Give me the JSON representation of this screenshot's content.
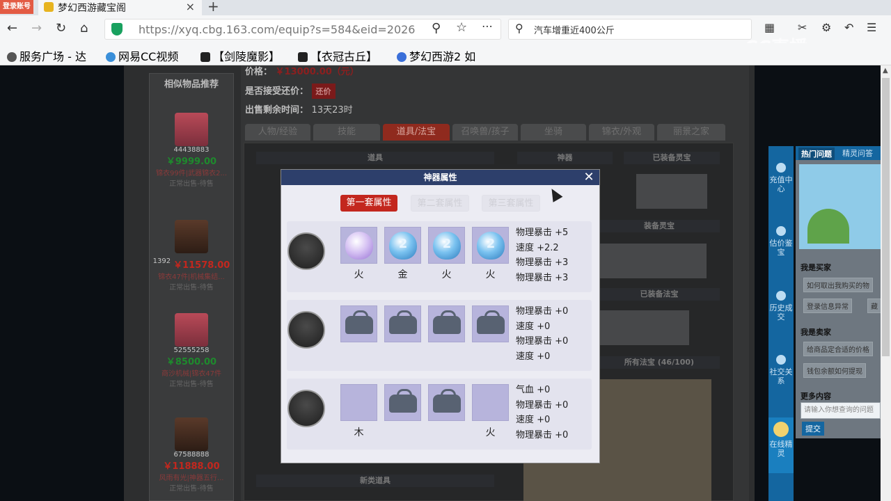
{
  "browser": {
    "login_badge": "登录账号",
    "tab_title": "梦幻西游藏宝阁",
    "tab_close": "×",
    "new_tab": "+",
    "url": "https://xyq.cbg.163.com/equip?s=584&eid=2026",
    "search_text": "汽车增重近400公斤",
    "watermark": "CC直播"
  },
  "bookmarks": [
    {
      "label": "服务广场 - 达",
      "icon": "globe-icon"
    },
    {
      "label": "网易CC视频",
      "icon": "cc-icon"
    },
    {
      "label": "【剑陵魔影】",
      "icon": "dashen-icon"
    },
    {
      "label": "【衣冠古丘】",
      "icon": "dashen-icon"
    },
    {
      "label": "梦幻西游2 如",
      "icon": "paw-icon"
    }
  ],
  "info": {
    "price_label": "价格：",
    "price_value": "￥13000.00（元）",
    "bargain_label": "是否接受还价：",
    "bargain_button": "还价",
    "remaining_label": "出售剩余时间：",
    "remaining_value": "13天23时"
  },
  "tabs": [
    "人物/经验",
    "技能",
    "道具/法宝",
    "召唤兽/孩子",
    "坐骑",
    "锦衣/外观",
    "丽景之家"
  ],
  "panels": {
    "items": "道具",
    "artifact": "神器",
    "spirit_equipped": "已装备灵宝",
    "spirit2": "装备灵宝",
    "fabao_equipped": "已装备法宝",
    "fabao_all": "所有法宝 (46/100)",
    "new_items": "新类道具"
  },
  "sidebar": {
    "title": "相似物品推荐",
    "items": [
      {
        "id": "44438883",
        "price": "￥9999.00",
        "desc": "锦衣99件|武器锦衣2...",
        "status": "正常出售-待售"
      },
      {
        "id": "1392",
        "price": "￥11578.00",
        "desc": "锦衣47件|机械集结...",
        "status": "正常出售-待售"
      },
      {
        "id": "52555258",
        "price": "￥8500.00",
        "desc": "商沙机械|锦衣47件",
        "status": "正常出售-待售"
      },
      {
        "id": "67588888",
        "price": "￥11888.00",
        "desc": "风雨有光|神器五行...",
        "status": "正常出售-待售"
      }
    ]
  },
  "right_tools": [
    {
      "label": "充值中心"
    },
    {
      "label": "估价鉴宝"
    },
    {
      "label": "历史成交"
    },
    {
      "label": "社交关系"
    },
    {
      "label": "在线精灵"
    }
  ],
  "help": {
    "tab_hot": "热门问题",
    "tab_sprite": "精灵问答",
    "buyer_heading": "我是买家",
    "buyer_q1": "如何取出我购买的物",
    "buyer_q2": "登录信息异常",
    "buyer_q3": "藏",
    "seller_heading": "我是卖家",
    "seller_q1": "给商品定合适的价格",
    "seller_q2": "钱包余额如何提现",
    "more_heading": "更多内容",
    "input_placeholder": "请输入你想查询的问题",
    "submit": "提交"
  },
  "modal": {
    "title": "神器属性",
    "close": "✕",
    "set_tabs": [
      "第一套属性",
      "第二套属性",
      "第三套属性"
    ],
    "rows": [
      {
        "slots": [
          {
            "type": "gem-purple",
            "num": "",
            "label": "火"
          },
          {
            "type": "gem",
            "num": "2",
            "label": "金"
          },
          {
            "type": "gem",
            "num": "2",
            "label": "火"
          },
          {
            "type": "gem",
            "num": "2",
            "label": "火"
          }
        ],
        "stats": [
          "物理暴击 +5",
          "速度 +2.2",
          "物理暴击 +3",
          "物理暴击 +3"
        ]
      },
      {
        "slots": [
          {
            "type": "lock",
            "label": ""
          },
          {
            "type": "lock",
            "label": ""
          },
          {
            "type": "lock",
            "label": ""
          },
          {
            "type": "lock",
            "label": ""
          }
        ],
        "stats": [
          "物理暴击 +0",
          "速度 +0",
          "物理暴击 +0",
          "速度 +0"
        ]
      },
      {
        "slots": [
          {
            "type": "empty",
            "label": "木"
          },
          {
            "type": "lock",
            "label": ""
          },
          {
            "type": "lock",
            "label": ""
          },
          {
            "type": "empty",
            "label": "火"
          }
        ],
        "stats": [
          "气血 +0",
          "物理暴击 +0",
          "速度 +0",
          "物理暴击 +0"
        ]
      }
    ]
  },
  "colors": {
    "accent_red": "#c3271e",
    "tool_blue": "#1466a0",
    "modal_header": "#2d3f6b",
    "slot_purple": "#b7b4dc",
    "price_green": "#1e8a2d"
  }
}
